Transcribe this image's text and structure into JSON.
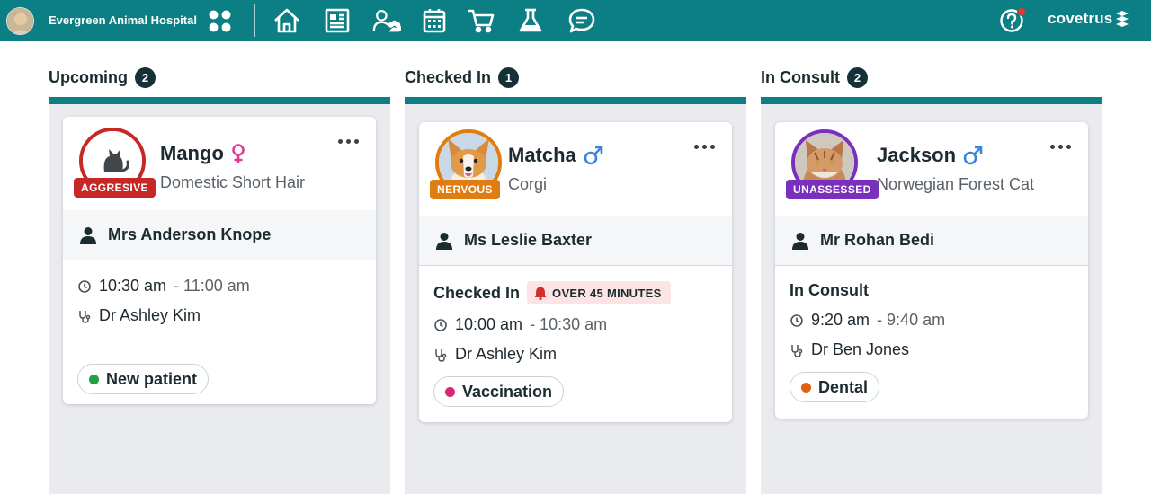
{
  "header": {
    "hospital_name": "Evergreen Animal Hospital",
    "brand": "covetrus",
    "nav_icons": [
      "apps-grid-icon",
      "home-icon",
      "whiteboard-icon",
      "clients-pets-icon",
      "calendar-icon",
      "cart-icon",
      "lab-flask-icon",
      "chat-icon",
      "help-icon"
    ],
    "accent_color": "#0b7f84"
  },
  "columns": [
    {
      "title": "Upcoming",
      "count": "2",
      "card": {
        "pet_name": "Mango",
        "sex_icon": "female-icon",
        "breed": "Domestic Short Hair",
        "temperament": "AGGRESIVE",
        "temperament_color": "#c62828",
        "owner": "Mrs Anderson Knope",
        "time_start": "10:30 am",
        "time_end": "- 11:00 am",
        "doctor": "Dr Ashley Kim",
        "appointment_type": "New patient",
        "type_color": "#22a045"
      }
    },
    {
      "title": "Checked In",
      "count": "1",
      "card": {
        "pet_name": "Matcha",
        "sex_icon": "male-icon",
        "breed": "Corgi",
        "temperament": "NERVOUS",
        "temperament_color": "#e07d10",
        "owner": "Ms Leslie Baxter",
        "status": "Checked In",
        "alert": "OVER 45 MINUTES",
        "time_start": "10:00 am",
        "time_end": "- 10:30 am",
        "doctor": "Dr Ashley Kim",
        "appointment_type": "Vaccination",
        "type_color": "#d92672"
      }
    },
    {
      "title": "In Consult",
      "count": "2",
      "card": {
        "pet_name": "Jackson",
        "sex_icon": "male-icon",
        "breed": "Norwegian Forest Cat",
        "temperament": "UNASSESSED",
        "temperament_color": "#7b2fbe",
        "owner": "Mr Rohan Bedi",
        "status": "In Consult",
        "time_start": "9:20 am",
        "time_end": "- 9:40 am",
        "doctor": "Dr Ben Jones",
        "appointment_type": "Dental",
        "type_color": "#e0600f"
      }
    }
  ]
}
